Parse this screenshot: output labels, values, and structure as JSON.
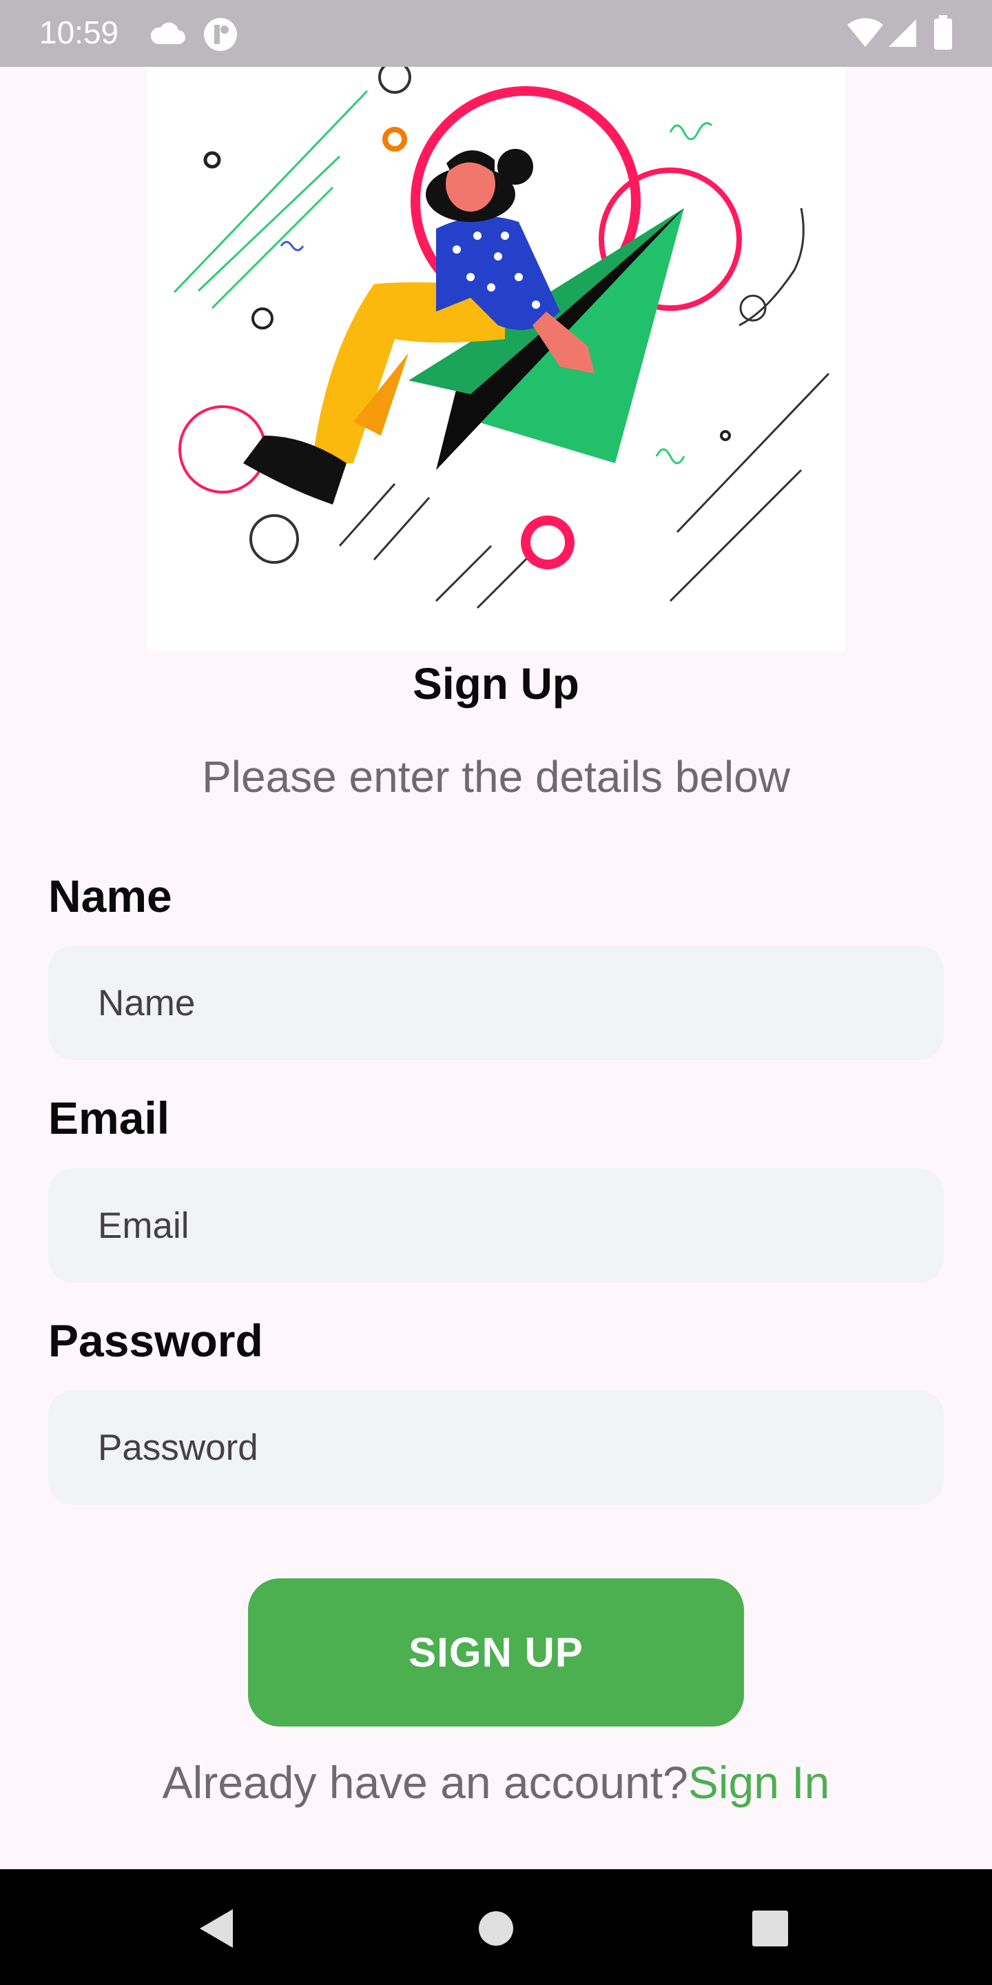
{
  "status_bar": {
    "time": "10:59",
    "left_icons": [
      "cloud-icon",
      "app-notification-icon"
    ],
    "right_icons": [
      "wifi-icon",
      "cellular-signal-icon",
      "battery-icon"
    ]
  },
  "header": {
    "illustration": "woman-riding-paper-plane-illustration",
    "title": "Sign Up",
    "subtitle": "Please enter the details below"
  },
  "form": {
    "name": {
      "label": "Name",
      "placeholder": "Name",
      "value": ""
    },
    "email": {
      "label": "Email",
      "placeholder": "Email",
      "value": ""
    },
    "password": {
      "label": "Password",
      "placeholder": "Password",
      "value": ""
    },
    "submit_label": "SIGN UP"
  },
  "footer": {
    "prompt": "Already have an account?",
    "link_label": "Sign In"
  },
  "nav_bar": {
    "buttons": [
      "back-icon",
      "home-icon",
      "recents-icon"
    ]
  },
  "colors": {
    "accent": "#4caf50",
    "background": "#fdf7fc",
    "field_background": "#f2f3f6",
    "muted_text": "#6f6a70"
  }
}
